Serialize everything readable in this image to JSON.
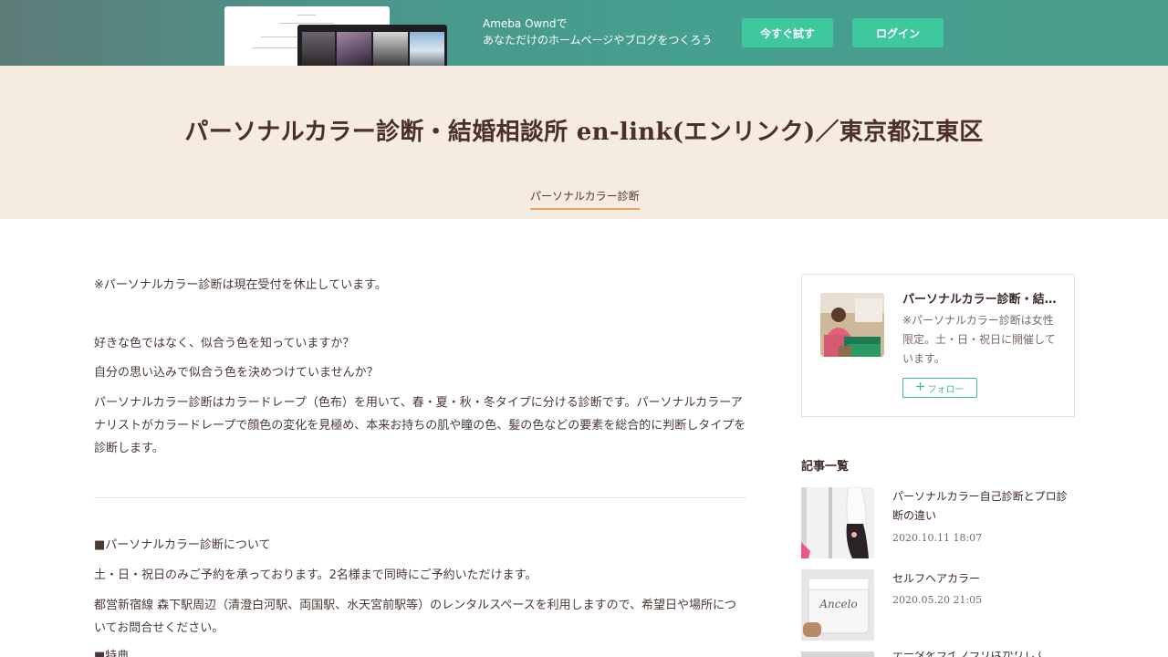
{
  "promo": {
    "line1": "Ameba Owndで",
    "line2": "あなただけのホームページやブログをつくろう",
    "try_button": "今すぐ試す",
    "login_button": "ログイン"
  },
  "header": {
    "title": "パーソナルカラー診断・結婚相談所 en-link(エンリンク)／東京都江東区",
    "nav": [
      "パーソナルカラー診断"
    ]
  },
  "article": {
    "paragraphs": [
      "※パーソナルカラー診断は現在受付を休止しています。",
      "好きな色ではなく、似合う色を知っていますか？",
      "自分の思い込みで似合う色を決めつけていませんか？",
      "パーソナルカラー診断はカラードレープ（色布）を用いて、春・夏・秋・冬タイプに分ける診断です。パーソナルカラーアナリストがカラードレープで顔色の変化を見極め、本来お持ちの肌や瞳の色、髪の色などの要素を総合的に判断しタイプを診断します。",
      "■パーソナルカラー診断について",
      "土・日・祝日のみご予約を承っております。2名様まで同時にご予約いただけます。",
      "都営新宿線 森下駅周辺（清澄白河駅、両国駅、水天宮前駅等）のレンタルスペースを利用しますので、希望日や場所についてお問合せください。",
      "■特典"
    ]
  },
  "sidebar": {
    "profile": {
      "name": "パーソナルカラー診断・結婚相談所 en-link",
      "description": "※パーソナルカラー診断は女性限定。土・日・祝日に開催しています。",
      "follow_label": "フォロー",
      "follow_icon": "plus-icon"
    },
    "list_heading": "記事一覧",
    "articles": [
      {
        "title": "パーソナルカラー自己診断とプロ診断の違い",
        "date": "2020.10.11 18:07"
      },
      {
        "title": "セルフヘアカラー",
        "date": "2020.05.20 21:05"
      },
      {
        "title": "データをライブラリばかりして",
        "date": ""
      }
    ]
  },
  "colors": {
    "accent": "#3fc89e",
    "header_bg": "#f6ebe0",
    "nav_underline": "#e4a463",
    "text": "#4a3a35"
  }
}
